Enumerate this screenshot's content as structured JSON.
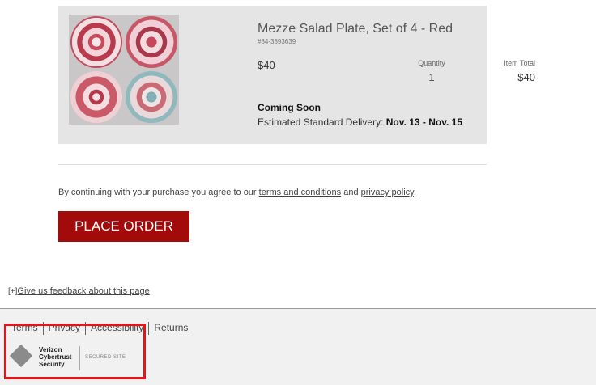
{
  "item": {
    "name": "Mezze Salad Plate, Set of 4 - Red",
    "sku": "#84-3893639",
    "price": "$40",
    "quantity_label": "Quantity",
    "quantity": "1",
    "item_total_label": "Item Total",
    "item_total": "$40",
    "availability": "Coming Soon",
    "delivery_prefix": "Estimated Standard Delivery:",
    "delivery_dates": "Nov. 13 - Nov. 15"
  },
  "agreement": {
    "prefix": "By continuing with your purchase you agree to our",
    "terms_link": "terms and conditions",
    "middle": "and",
    "privacy_link": "privacy policy",
    "suffix": "."
  },
  "place_order_label": "PLACE ORDER",
  "feedback": {
    "toggle": "[+]",
    "link": "Give us feedback about this page"
  },
  "footer": {
    "links": [
      "Terms",
      "Privacy",
      "Accessibility",
      "Returns"
    ],
    "seal": {
      "line1": "Verizon",
      "line2": "Cybertrust",
      "line3": "Security",
      "secured": "SECURED SITE"
    }
  },
  "colors": {
    "accent": "#a30b0b",
    "card_bg": "#e5e5e5",
    "highlight": "#e3151a"
  }
}
